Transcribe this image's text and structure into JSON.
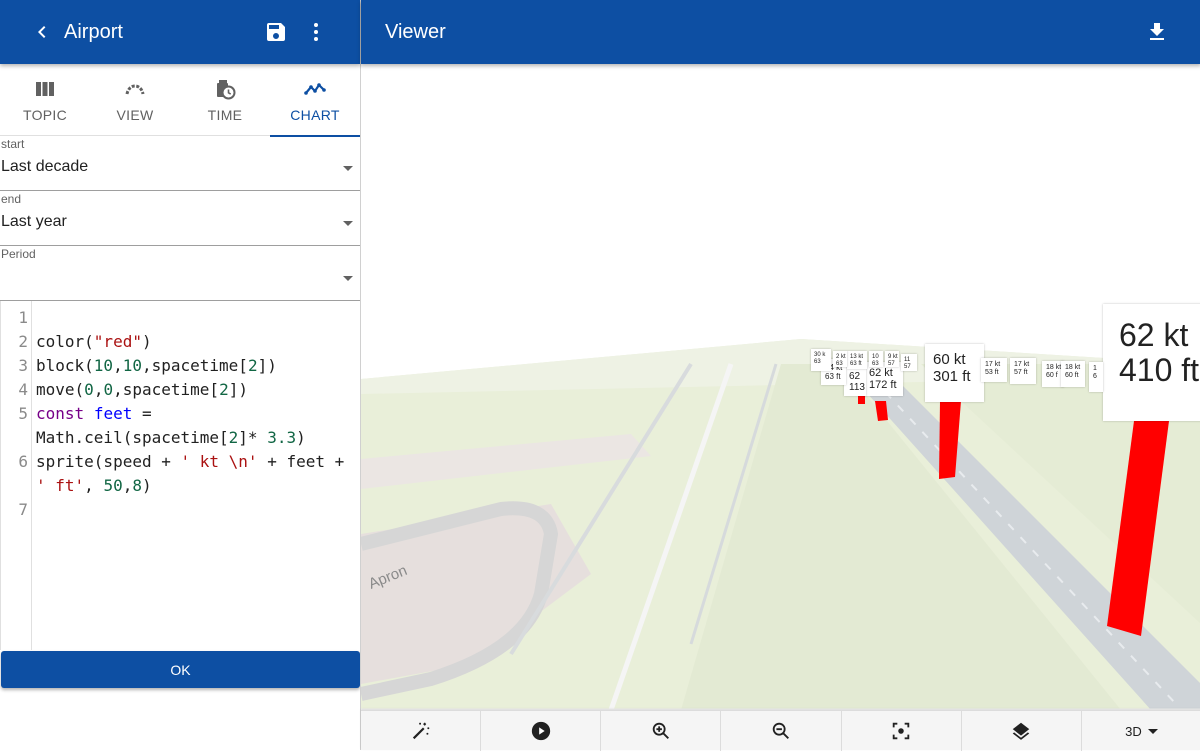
{
  "left_panel": {
    "title": "Airport",
    "tabs": [
      {
        "label": "TOPIC",
        "icon": "columns-icon"
      },
      {
        "label": "VIEW",
        "icon": "view-icon"
      },
      {
        "label": "TIME",
        "icon": "time-icon"
      },
      {
        "label": "CHART",
        "icon": "chart-icon"
      }
    ],
    "active_tab": "CHART",
    "fields": {
      "start": {
        "label": "start",
        "value": "Last decade"
      },
      "end": {
        "label": "end",
        "value": "Last year"
      },
      "period": {
        "label": "Period",
        "value": ""
      }
    },
    "editor": {
      "line_numbers": [
        "1",
        "2",
        "3",
        "4",
        "5",
        "6",
        "7"
      ],
      "code": [
        "",
        "color(\"red\")",
        "block(10,10,spacetime[2])",
        "move(0,0,spacetime[2])",
        "const feet =",
        "Math.ceil(spacetime[2]* 3.3)",
        "sprite(speed + ' kt \\n' + feet +",
        "' ft', 50,8)",
        ""
      ]
    },
    "ok_label": "OK"
  },
  "right_panel": {
    "title": "Viewer",
    "map": {
      "label_text": "Apron",
      "sprites": [
        {
          "line1": "62 kt",
          "line2": "410 ft"
        },
        {
          "line1": "60 kt",
          "line2": "301 ft"
        },
        {
          "line1": "62 kt",
          "line2": "172 ft"
        },
        {
          "line1": "62",
          "line2": "113"
        },
        {
          "line1": "54 kt",
          "line2": "63 ft"
        },
        {
          "line1": "30 k",
          "line2": "63"
        },
        {
          "line1": "13 kt",
          "line2": "63 ft"
        },
        {
          "line1": "2 kt",
          "line2": "63"
        },
        {
          "line1": "10",
          "line2": "63"
        },
        {
          "line1": "9 kt",
          "line2": "57"
        },
        {
          "line1": "11",
          "line2": "57"
        },
        {
          "line1": "17 kt",
          "line2": "53 ft"
        },
        {
          "line1": "17 kt",
          "line2": "57 ft"
        },
        {
          "line1": "18 kt",
          "line2": "60 f"
        },
        {
          "line1": "18 kt",
          "line2": "60 ft"
        },
        {
          "line1": "1",
          "line2": "6"
        }
      ],
      "bar_color": "#ff0000"
    },
    "toolbar": {
      "buttons": [
        {
          "icon": "magic-wand-icon"
        },
        {
          "icon": "play-icon"
        },
        {
          "icon": "zoom-in-icon"
        },
        {
          "icon": "zoom-out-icon"
        },
        {
          "icon": "focus-icon"
        },
        {
          "icon": "layers-icon"
        }
      ],
      "mode": "3D"
    }
  },
  "colors": {
    "primary": "#0d4fa3",
    "grass": "#e9efd9",
    "runway": "#d2d6da"
  }
}
